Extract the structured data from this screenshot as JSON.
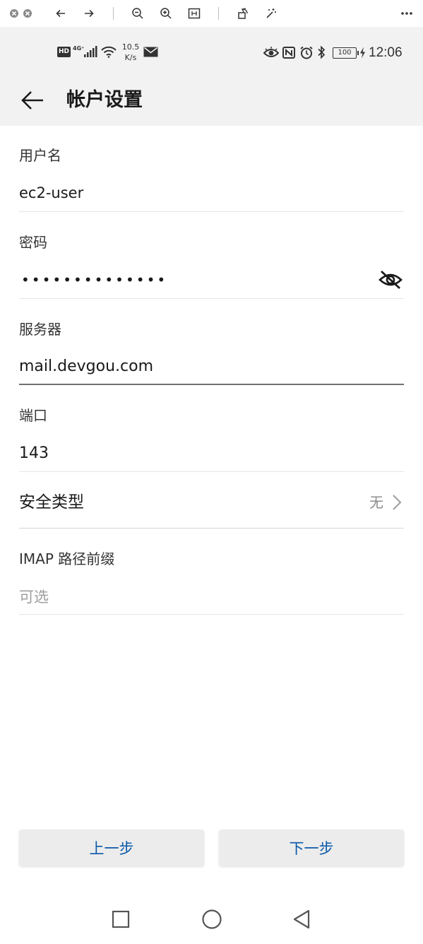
{
  "viewer": {
    "icons": [
      "close-circle-icon",
      "close-circle-icon",
      "arrow-left-icon",
      "arrow-right-icon",
      "zoom-out-icon",
      "zoom-in-icon",
      "fit-icon",
      "rotate-icon",
      "magic-wand-icon",
      "more-icon"
    ]
  },
  "statusbar": {
    "hd": "HD",
    "network": "4G⁺",
    "speed_value": "10.5",
    "speed_unit": "K/s",
    "battery": "100",
    "time": "12:06"
  },
  "appbar": {
    "title": "帐户设置"
  },
  "form": {
    "username": {
      "label": "用户名",
      "value": "ec2-user"
    },
    "password": {
      "label": "密码",
      "masked": "••••••••••••••"
    },
    "server": {
      "label": "服务器",
      "value": "mail.devgou.com"
    },
    "port": {
      "label": "端口",
      "value": "143"
    },
    "security": {
      "label": "安全类型",
      "value": "无"
    },
    "imap_prefix": {
      "label": "IMAP 路径前缀",
      "placeholder": "可选"
    }
  },
  "buttons": {
    "previous": "上一步",
    "next": "下一步"
  },
  "colors": {
    "accent": "#0a59a8",
    "bar_bg": "#f2f2f2",
    "button_bg": "#ececec"
  }
}
